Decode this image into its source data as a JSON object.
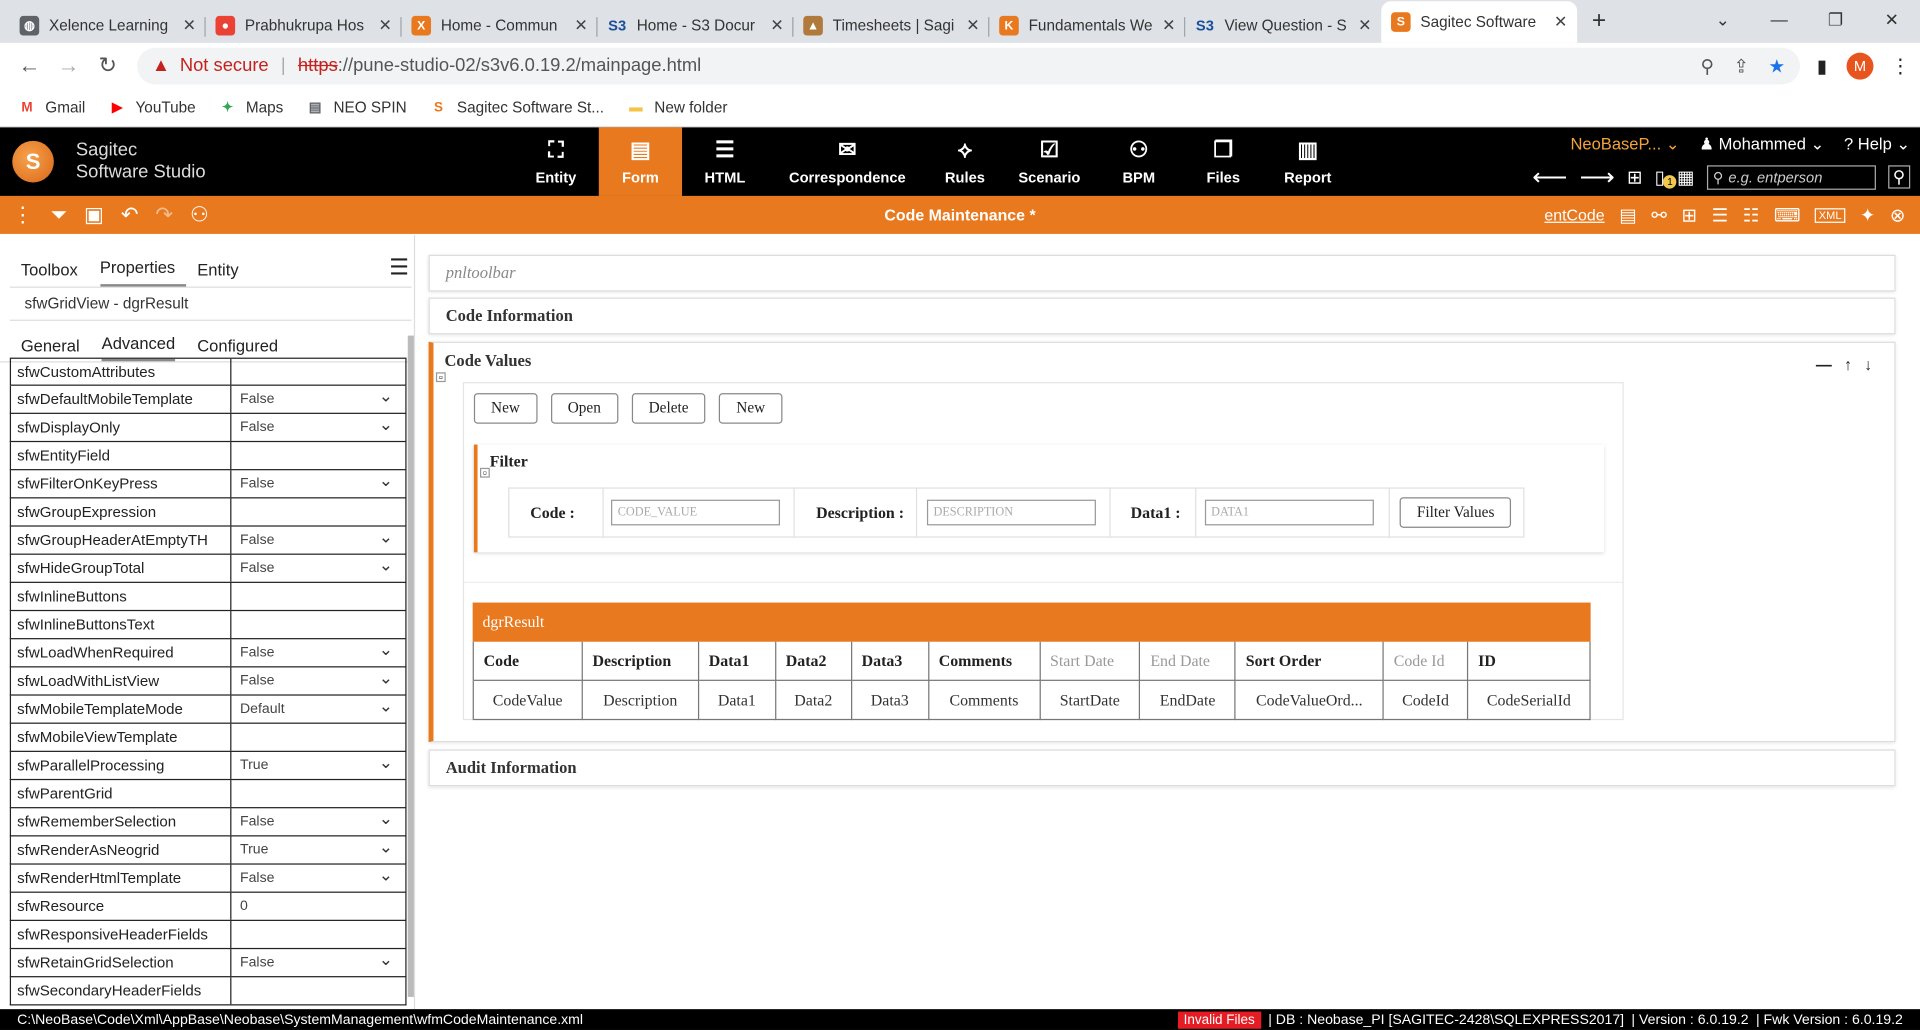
{
  "browser": {
    "tabs": [
      {
        "title": "Xelence Learning",
        "icon": "globe-icon",
        "color": "#5f6368"
      },
      {
        "title": "Prabhukrupa Hos",
        "icon": "maps-pin-icon",
        "color": "#ea4335"
      },
      {
        "title": "Home - Commun",
        "icon": "x-logo-icon",
        "color": "#e8791e"
      },
      {
        "title": "Home - S3 Docur",
        "icon": "s3-icon",
        "color": "#1a4f9c"
      },
      {
        "title": "Timesheets | Sagi",
        "icon": "timesheet-icon",
        "color": "#b07a3c"
      },
      {
        "title": "Fundamentals We",
        "icon": "k-logo-icon",
        "color": "#e8791e"
      },
      {
        "title": "View Question - S",
        "icon": "s3-icon",
        "color": "#1a4f9c"
      },
      {
        "title": "Sagitec Software",
        "icon": "sagitec-icon",
        "color": "#e8791e"
      }
    ],
    "not_secure": "Not secure",
    "url_scheme": "https",
    "url_rest": "://pune-studio-02/s3v6.0.19.2/mainpage.html",
    "avatar_letter": "M",
    "bookmarks": [
      {
        "label": "Gmail",
        "icon": "gmail-icon",
        "color": "#ea4335"
      },
      {
        "label": "YouTube",
        "icon": "youtube-icon",
        "color": "#ff0000"
      },
      {
        "label": "Maps",
        "icon": "maps-icon",
        "color": "#34a853"
      },
      {
        "label": "NEO SPIN",
        "icon": "page-icon",
        "color": "#5f6368"
      },
      {
        "label": "Sagitec Software St...",
        "icon": "sagitec-icon",
        "color": "#e8791e"
      },
      {
        "label": "New folder",
        "icon": "folder-icon",
        "color": "#f6c343"
      }
    ]
  },
  "app": {
    "logo_line1": "Sagitec",
    "logo_line2": "Software Studio",
    "nav": [
      {
        "label": "Entity",
        "glyph": "⛶"
      },
      {
        "label": "Form",
        "glyph": "▤",
        "active": true
      },
      {
        "label": "HTML",
        "glyph": "☰"
      },
      {
        "label": "Correspondence",
        "glyph": "✉"
      },
      {
        "label": "Rules",
        "glyph": "⟡"
      },
      {
        "label": "Scenario",
        "glyph": "☑"
      },
      {
        "label": "BPM",
        "glyph": "⚇"
      },
      {
        "label": "Files",
        "glyph": "❐"
      },
      {
        "label": "Report",
        "glyph": "▥"
      }
    ],
    "project": "NeoBaseP...",
    "user": "Mohammed",
    "help": "Help",
    "search_placeholder": "e.g. entperson",
    "badge": "1"
  },
  "toolbar": {
    "title": "Code Maintenance *",
    "entity_link": "entCode"
  },
  "leftpanel": {
    "tabs": [
      "Toolbox",
      "Properties",
      "Entity"
    ],
    "selected_control": "sfwGridView - dgrResult",
    "subtabs": [
      "General",
      "Advanced",
      "Configured"
    ],
    "properties": [
      {
        "name": "sfwCustomAttributes",
        "value": "",
        "dropdown": false
      },
      {
        "name": "sfwDefaultMobileTemplate",
        "value": "False",
        "dropdown": true
      },
      {
        "name": "sfwDisplayOnly",
        "value": "False",
        "dropdown": true
      },
      {
        "name": "sfwEntityField",
        "value": "",
        "dropdown": false
      },
      {
        "name": "sfwFilterOnKeyPress",
        "value": "False",
        "dropdown": true
      },
      {
        "name": "sfwGroupExpression",
        "value": "",
        "dropdown": false
      },
      {
        "name": "sfwGroupHeaderAtEmptyTH",
        "value": "False",
        "dropdown": true
      },
      {
        "name": "sfwHideGroupTotal",
        "value": "False",
        "dropdown": true
      },
      {
        "name": "sfwInlineButtons",
        "value": "",
        "dropdown": false
      },
      {
        "name": "sfwInlineButtonsText",
        "value": "",
        "dropdown": false
      },
      {
        "name": "sfwLoadWhenRequired",
        "value": "False",
        "dropdown": true
      },
      {
        "name": "sfwLoadWithListView",
        "value": "False",
        "dropdown": true
      },
      {
        "name": "sfwMobileTemplateMode",
        "value": "Default",
        "dropdown": true
      },
      {
        "name": "sfwMobileViewTemplate",
        "value": "",
        "dropdown": false
      },
      {
        "name": "sfwParallelProcessing",
        "value": "True",
        "dropdown": true
      },
      {
        "name": "sfwParentGrid",
        "value": "",
        "dropdown": false
      },
      {
        "name": "sfwRememberSelection",
        "value": "False",
        "dropdown": true
      },
      {
        "name": "sfwRenderAsNeogrid",
        "value": "True",
        "dropdown": true
      },
      {
        "name": "sfwRenderHtmlTemplate",
        "value": "False",
        "dropdown": true
      },
      {
        "name": "sfwResource",
        "value": "0",
        "dropdown": false
      },
      {
        "name": "sfwResponsiveHeaderFields",
        "value": "",
        "dropdown": false
      },
      {
        "name": "sfwRetainGridSelection",
        "value": "False",
        "dropdown": true
      },
      {
        "name": "sfwSecondaryHeaderFields",
        "value": "",
        "dropdown": false
      }
    ]
  },
  "form": {
    "pnltoolbar": "pnltoolbar",
    "code_info": "Code Information",
    "code_values": "Code Values",
    "buttons": [
      "New",
      "Open",
      "Delete",
      "New"
    ],
    "filter": {
      "title": "Filter",
      "code_label": "Code :",
      "code_placeholder": "CODE_VALUE",
      "desc_label": "Description :",
      "desc_placeholder": "DESCRIPTION",
      "data1_label": "Data1 :",
      "data1_placeholder": "DATA1",
      "button": "Filter Values"
    },
    "grid": {
      "name": "dgrResult",
      "columns": [
        {
          "header": "Code",
          "value": "CodeValue",
          "dim": false
        },
        {
          "header": "Description",
          "value": "Description",
          "dim": false
        },
        {
          "header": "Data1",
          "value": "Data1",
          "dim": false
        },
        {
          "header": "Data2",
          "value": "Data2",
          "dim": false
        },
        {
          "header": "Data3",
          "value": "Data3",
          "dim": false
        },
        {
          "header": "Comments",
          "value": "Comments",
          "dim": false
        },
        {
          "header": "Start Date",
          "value": "StartDate",
          "dim": true
        },
        {
          "header": "End Date",
          "value": "EndDate",
          "dim": true
        },
        {
          "header": "Sort Order",
          "value": "CodeValueOrd...",
          "dim": false
        },
        {
          "header": "Code Id",
          "value": "CodeId",
          "dim": true
        },
        {
          "header": "ID",
          "value": "CodeSerialId",
          "dim": false
        }
      ]
    },
    "audit_info": "Audit Information"
  },
  "status": {
    "path": "C:\\NeoBase\\Code\\Xml\\AppBase\\Neobase\\SystemManagement\\wfmCodeMaintenance.xml",
    "invalid": "Invalid Files",
    "db": "| DB : Neobase_PI [SAGITEC-2428\\SQLEXPRESS2017]",
    "version": "| Version : 6.0.19.2",
    "fwk": "| Fwk Version : 6.0.19.2"
  }
}
